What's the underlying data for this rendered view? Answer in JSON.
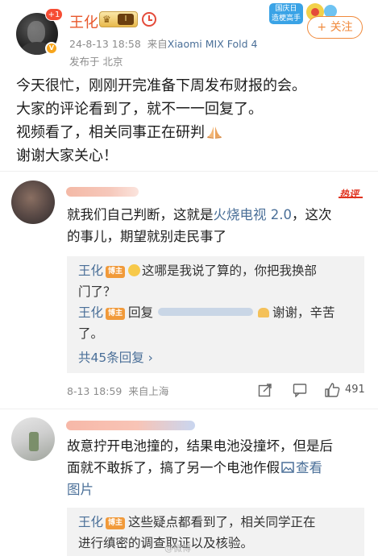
{
  "post": {
    "author": "王化",
    "notification_count": "+1",
    "vip_level": "I",
    "timestamp": "24-8-13 18:58",
    "source_prefix": "来自",
    "device": "Xiaomi MIX Fold 4",
    "location": "发布于 北京",
    "follow_label": "+ 关注",
    "holiday_tag": "国庆日\n造梗高手",
    "lines": [
      "今天很忙，刚刚开完准备下周发布财报的会。",
      "大家的评论看到了，就不一一回复了。",
      "视频看了，相关同事正在研判",
      "谢谢大家关心！"
    ]
  },
  "comments": [
    {
      "hot_label": "热评",
      "lines": [
        "就我们自己判断，这就是",
        "火烧电视 2.0",
        "，这次",
        "的事儿，期望就别走民事了"
      ],
      "replies": [
        {
          "name": "王化",
          "tag": "博主",
          "text_1": "这哪是我说了算的，你把我换部",
          "text_2": "门了？"
        },
        {
          "name": "王化",
          "tag": "博主",
          "prefix": "回复",
          "text_1": "谢谢，辛苦",
          "text_2": "了。"
        }
      ],
      "more_replies": "共45条回复 ›",
      "time": "8-13 18:59",
      "location": "来自上海",
      "likes": "491"
    },
    {
      "lines": [
        "故意拧开电池撞的，结果电池没撞坏，但是后",
        "面就不敢拆了，搞了另一个电池作假",
        "查看",
        "图片"
      ],
      "reply": {
        "name": "王化",
        "tag": "博主",
        "text_1": "这些疑点都看到了，相关同学正在",
        "text_2": "进行缜密的调查取证以及核验。"
      }
    }
  ],
  "watermark": "@微博"
}
